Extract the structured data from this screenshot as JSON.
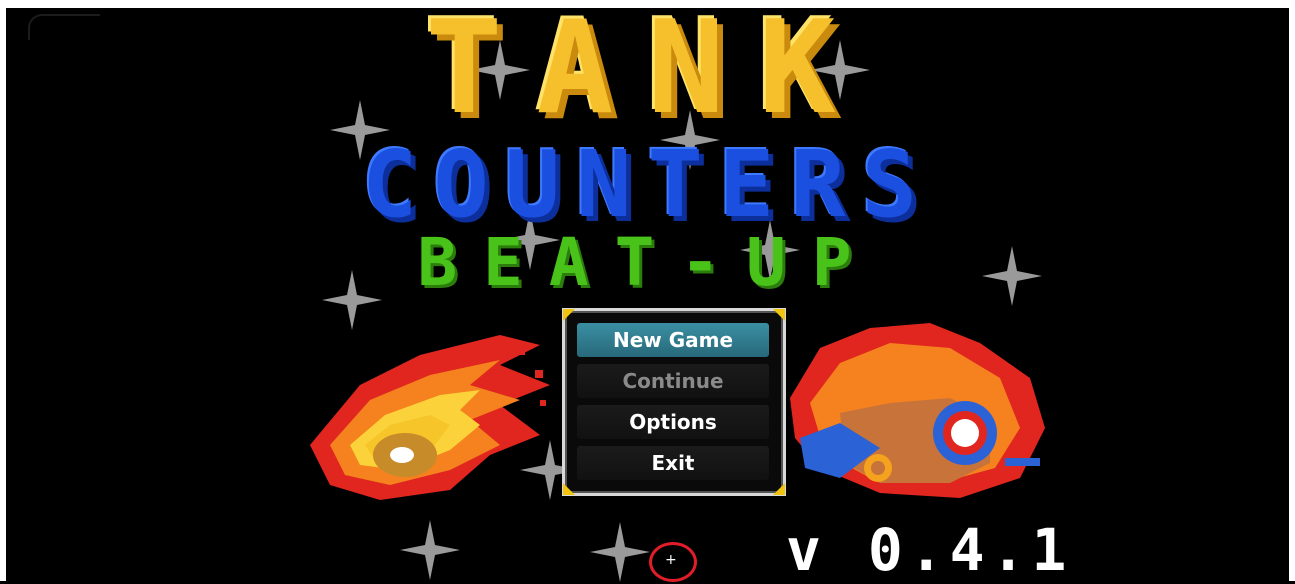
{
  "title": {
    "line1": "TANK",
    "line2": "COUNTERS",
    "line3": "BEAT-UP"
  },
  "menu": {
    "items": [
      {
        "label": "New Game",
        "state": "selected"
      },
      {
        "label": "Continue",
        "state": "disabled"
      },
      {
        "label": "Options",
        "state": "normal"
      },
      {
        "label": "Exit",
        "state": "normal"
      }
    ]
  },
  "version": "v 0.4.1",
  "colors": {
    "title_yellow": "#f6c02c",
    "title_blue": "#1b4fe0",
    "title_green": "#49c21a",
    "menu_selected": "#3b8fa3",
    "cursor_ring": "#e21d2a"
  },
  "icons": {
    "left_art": "fireball-icon",
    "right_art": "flying-tank-character-icon",
    "cursor": "crosshair-cursor-icon"
  }
}
